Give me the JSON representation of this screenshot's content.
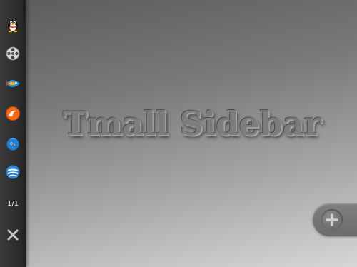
{
  "sidebar": {
    "items": [
      {
        "icon": "penguin-icon"
      },
      {
        "icon": "film-reel-icon"
      },
      {
        "icon": "rocket-fish-icon"
      },
      {
        "icon": "orange-swirl-icon"
      },
      {
        "icon": "blue-bird-icon"
      },
      {
        "icon": "blue-stack-icon"
      }
    ],
    "pager": "1/1",
    "close_icon": "close-icon"
  },
  "main": {
    "title": "Tmall Sidebar"
  },
  "add_button": {
    "icon": "plus-icon"
  }
}
